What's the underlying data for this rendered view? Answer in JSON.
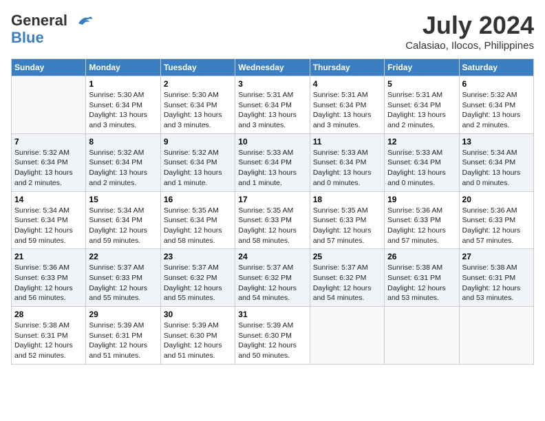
{
  "header": {
    "logo_line1": "General",
    "logo_line2": "Blue",
    "month_year": "July 2024",
    "location": "Calasiao, Ilocos, Philippines"
  },
  "days_of_week": [
    "Sunday",
    "Monday",
    "Tuesday",
    "Wednesday",
    "Thursday",
    "Friday",
    "Saturday"
  ],
  "weeks": [
    [
      {
        "day": "",
        "info": ""
      },
      {
        "day": "1",
        "info": "Sunrise: 5:30 AM\nSunset: 6:34 PM\nDaylight: 13 hours\nand 3 minutes."
      },
      {
        "day": "2",
        "info": "Sunrise: 5:30 AM\nSunset: 6:34 PM\nDaylight: 13 hours\nand 3 minutes."
      },
      {
        "day": "3",
        "info": "Sunrise: 5:31 AM\nSunset: 6:34 PM\nDaylight: 13 hours\nand 3 minutes."
      },
      {
        "day": "4",
        "info": "Sunrise: 5:31 AM\nSunset: 6:34 PM\nDaylight: 13 hours\nand 3 minutes."
      },
      {
        "day": "5",
        "info": "Sunrise: 5:31 AM\nSunset: 6:34 PM\nDaylight: 13 hours\nand 2 minutes."
      },
      {
        "day": "6",
        "info": "Sunrise: 5:32 AM\nSunset: 6:34 PM\nDaylight: 13 hours\nand 2 minutes."
      }
    ],
    [
      {
        "day": "7",
        "info": "Sunrise: 5:32 AM\nSunset: 6:34 PM\nDaylight: 13 hours\nand 2 minutes."
      },
      {
        "day": "8",
        "info": "Sunrise: 5:32 AM\nSunset: 6:34 PM\nDaylight: 13 hours\nand 2 minutes."
      },
      {
        "day": "9",
        "info": "Sunrise: 5:32 AM\nSunset: 6:34 PM\nDaylight: 13 hours\nand 1 minute."
      },
      {
        "day": "10",
        "info": "Sunrise: 5:33 AM\nSunset: 6:34 PM\nDaylight: 13 hours\nand 1 minute."
      },
      {
        "day": "11",
        "info": "Sunrise: 5:33 AM\nSunset: 6:34 PM\nDaylight: 13 hours\nand 0 minutes."
      },
      {
        "day": "12",
        "info": "Sunrise: 5:33 AM\nSunset: 6:34 PM\nDaylight: 13 hours\nand 0 minutes."
      },
      {
        "day": "13",
        "info": "Sunrise: 5:34 AM\nSunset: 6:34 PM\nDaylight: 13 hours\nand 0 minutes."
      }
    ],
    [
      {
        "day": "14",
        "info": "Sunrise: 5:34 AM\nSunset: 6:34 PM\nDaylight: 12 hours\nand 59 minutes."
      },
      {
        "day": "15",
        "info": "Sunrise: 5:34 AM\nSunset: 6:34 PM\nDaylight: 12 hours\nand 59 minutes."
      },
      {
        "day": "16",
        "info": "Sunrise: 5:35 AM\nSunset: 6:34 PM\nDaylight: 12 hours\nand 58 minutes."
      },
      {
        "day": "17",
        "info": "Sunrise: 5:35 AM\nSunset: 6:33 PM\nDaylight: 12 hours\nand 58 minutes."
      },
      {
        "day": "18",
        "info": "Sunrise: 5:35 AM\nSunset: 6:33 PM\nDaylight: 12 hours\nand 57 minutes."
      },
      {
        "day": "19",
        "info": "Sunrise: 5:36 AM\nSunset: 6:33 PM\nDaylight: 12 hours\nand 57 minutes."
      },
      {
        "day": "20",
        "info": "Sunrise: 5:36 AM\nSunset: 6:33 PM\nDaylight: 12 hours\nand 57 minutes."
      }
    ],
    [
      {
        "day": "21",
        "info": "Sunrise: 5:36 AM\nSunset: 6:33 PM\nDaylight: 12 hours\nand 56 minutes."
      },
      {
        "day": "22",
        "info": "Sunrise: 5:37 AM\nSunset: 6:33 PM\nDaylight: 12 hours\nand 55 minutes."
      },
      {
        "day": "23",
        "info": "Sunrise: 5:37 AM\nSunset: 6:32 PM\nDaylight: 12 hours\nand 55 minutes."
      },
      {
        "day": "24",
        "info": "Sunrise: 5:37 AM\nSunset: 6:32 PM\nDaylight: 12 hours\nand 54 minutes."
      },
      {
        "day": "25",
        "info": "Sunrise: 5:37 AM\nSunset: 6:32 PM\nDaylight: 12 hours\nand 54 minutes."
      },
      {
        "day": "26",
        "info": "Sunrise: 5:38 AM\nSunset: 6:31 PM\nDaylight: 12 hours\nand 53 minutes."
      },
      {
        "day": "27",
        "info": "Sunrise: 5:38 AM\nSunset: 6:31 PM\nDaylight: 12 hours\nand 53 minutes."
      }
    ],
    [
      {
        "day": "28",
        "info": "Sunrise: 5:38 AM\nSunset: 6:31 PM\nDaylight: 12 hours\nand 52 minutes."
      },
      {
        "day": "29",
        "info": "Sunrise: 5:39 AM\nSunset: 6:31 PM\nDaylight: 12 hours\nand 51 minutes."
      },
      {
        "day": "30",
        "info": "Sunrise: 5:39 AM\nSunset: 6:30 PM\nDaylight: 12 hours\nand 51 minutes."
      },
      {
        "day": "31",
        "info": "Sunrise: 5:39 AM\nSunset: 6:30 PM\nDaylight: 12 hours\nand 50 minutes."
      },
      {
        "day": "",
        "info": ""
      },
      {
        "day": "",
        "info": ""
      },
      {
        "day": "",
        "info": ""
      }
    ]
  ]
}
